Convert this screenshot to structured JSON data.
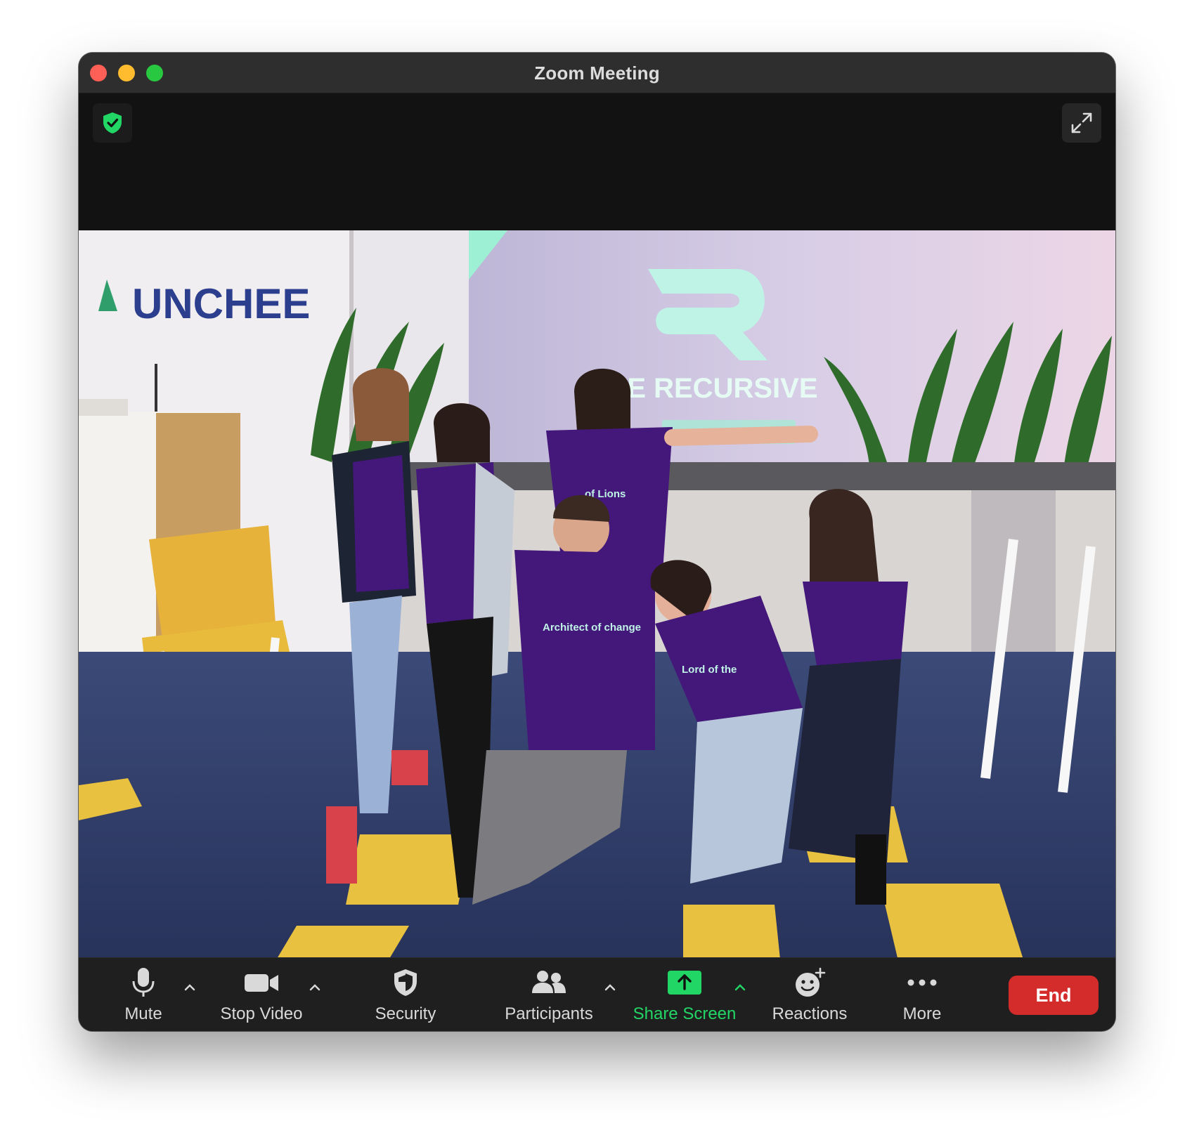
{
  "window": {
    "title": "Zoom Meeting"
  },
  "scene": {
    "wall_sign": "UNCHEE",
    "screen_text": "THE RECURSIVE",
    "shirts": {
      "left": "of Lions",
      "center": "Architect of change",
      "right": "Lord of the"
    }
  },
  "toolbar": {
    "mute_label": "Mute",
    "stop_video_label": "Stop Video",
    "security_label": "Security",
    "participants_label": "Participants",
    "share_screen_label": "Share Screen",
    "reactions_label": "Reactions",
    "more_label": "More",
    "end_label": "End"
  },
  "colors": {
    "share_green": "#22d665",
    "end_red": "#d42b2b",
    "shield_green": "#22d665",
    "shirt_purple": "#44177a"
  },
  "icons": [
    "shield-check-icon",
    "fullscreen-icon",
    "microphone-icon",
    "video-camera-icon",
    "security-shield-icon",
    "participants-icon",
    "share-screen-icon",
    "reactions-icon",
    "more-dots-icon",
    "caret-up-icon"
  ]
}
